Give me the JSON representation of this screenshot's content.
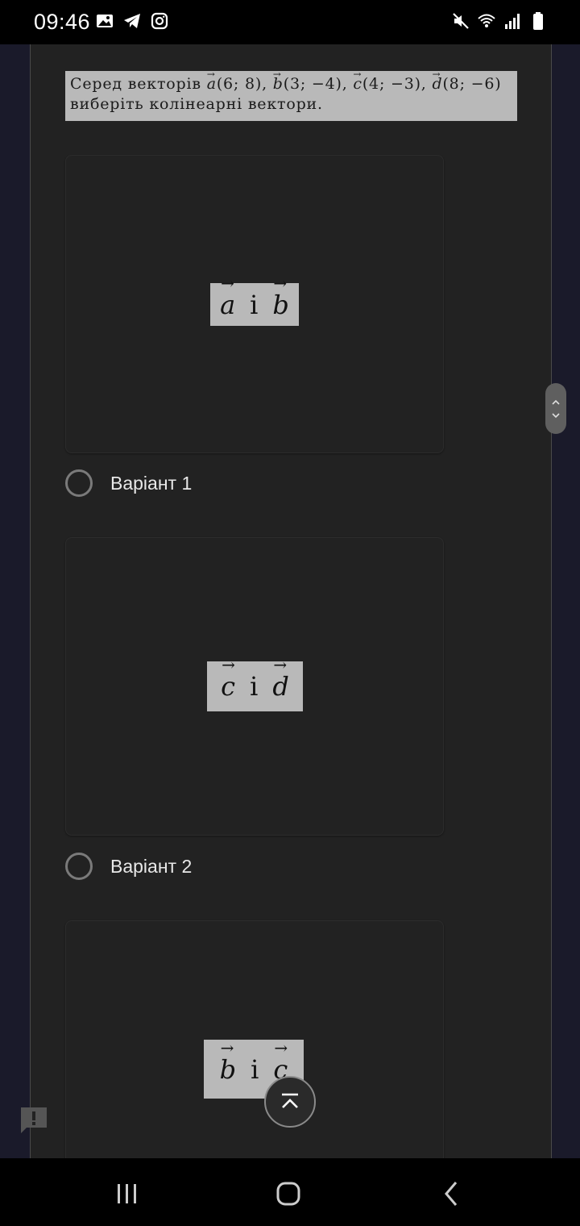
{
  "status_bar": {
    "time": "09:46",
    "left_icons": [
      "image-icon",
      "telegram-icon",
      "instagram-icon"
    ],
    "right_icons": [
      "mute-icon",
      "wifi-icon",
      "signal-icon",
      "battery-icon"
    ]
  },
  "question": {
    "line1_prefix": "Серед векторів",
    "line1_vectors": [
      {
        "name": "a",
        "coords": "(6; 8),"
      },
      {
        "name": "b",
        "coords": "(3; −4),"
      },
      {
        "name": "c",
        "coords": "(4; −3),"
      },
      {
        "name": "d",
        "coords": "(8; −6)"
      }
    ],
    "line2": "виберіть колінеарні вектори."
  },
  "options": [
    {
      "vec1": "a",
      "conj": "і",
      "vec2": "b",
      "label": "Варіант 1"
    },
    {
      "vec1": "c",
      "conj": "і",
      "vec2": "d",
      "label": "Варіант 2"
    },
    {
      "vec1": "b",
      "conj": "і",
      "vec2": "c"
    }
  ],
  "colors": {
    "background": "#222222",
    "formula_bg": "#b9b9b9",
    "text": "#e8e8e8"
  }
}
